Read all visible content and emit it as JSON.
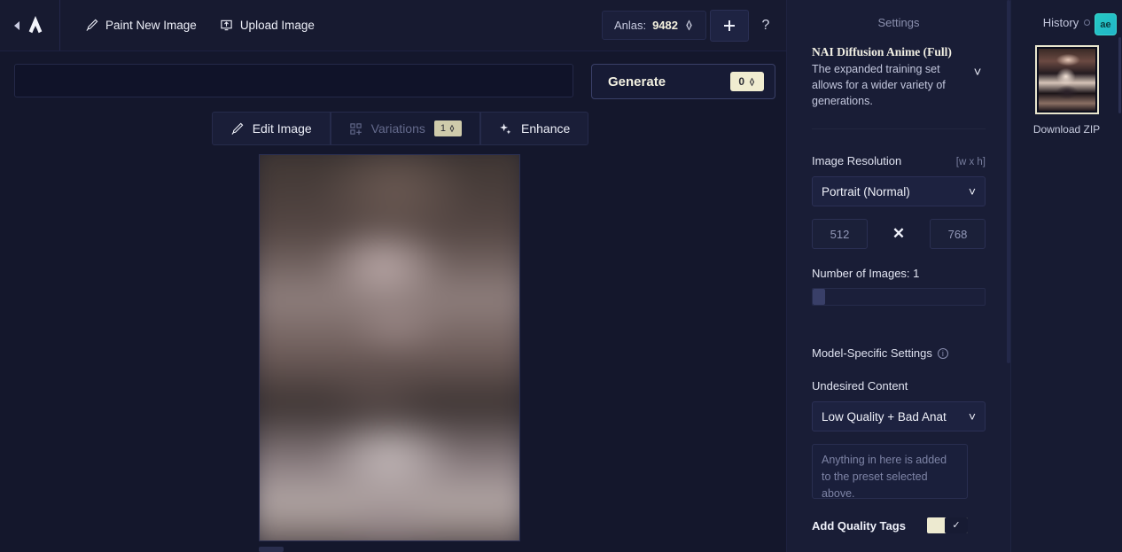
{
  "topbar": {
    "collapse_icon": "chevron-left-icon",
    "logo_icon": "novelai-logo",
    "paint_new_image": "Paint New Image",
    "paint_icon": "brush-icon",
    "upload_image": "Upload Image",
    "upload_icon": "upload-icon",
    "anlas_label": "Anlas:",
    "anlas_value": "9482",
    "anlas_icon": "anlas-icon",
    "add_icon": "plus-icon",
    "help_label": "?"
  },
  "prompt": {
    "value": "",
    "placeholder": ""
  },
  "generate": {
    "label": "Generate",
    "cost": "0",
    "cost_icon": "anlas-icon"
  },
  "tabs": [
    {
      "label": "Edit Image",
      "icon": "brush-icon",
      "disabled": false,
      "badge": ""
    },
    {
      "label": "Variations",
      "icon": "grid-plus-icon",
      "disabled": true,
      "badge": "1"
    },
    {
      "label": "Enhance",
      "icon": "sparkle-icon",
      "disabled": false,
      "badge": ""
    }
  ],
  "canvas": {
    "image_alt": "generated-image-blurred"
  },
  "settings": {
    "title": "Settings",
    "model": {
      "name": "NAI Diffusion Anime (Full)",
      "description": "The expanded training set allows for a wider variety of generations.",
      "chevron_icon": "chevron-down-icon"
    },
    "resolution": {
      "label": "Image Resolution",
      "hint": "[w x h]",
      "preset": "Portrait (Normal)",
      "chevron_icon": "chevron-down-icon",
      "width": "512",
      "height": "768",
      "times_icon": "multiply-icon"
    },
    "number_of_images": {
      "label": "Number of Images:",
      "value": "1"
    },
    "model_specific": {
      "label": "Model-Specific Settings",
      "info_icon": "info-icon"
    },
    "undesired_content": {
      "label": "Undesired Content",
      "preset": "Low Quality + Bad Anat",
      "chevron_icon": "chevron-down-icon",
      "textarea_value": "",
      "textarea_placeholder": "Anything in here is added to the preset selected above."
    },
    "quality_tags": {
      "label": "Add Quality Tags",
      "state": "on",
      "check_icon": "check-icon"
    }
  },
  "history": {
    "title": "History",
    "status_icon": "circle-icon",
    "extension_badge": "ae",
    "thumbnail_alt": "history-thumbnail-1",
    "download_zip": "Download ZIP"
  },
  "colors": {
    "background": "#13162b",
    "panel": "#191d36",
    "accent_cream": "#f0ecd0",
    "text_primary": "#eceef7",
    "text_muted": "#8b90ae",
    "badge_teal": "#25c9c3"
  }
}
